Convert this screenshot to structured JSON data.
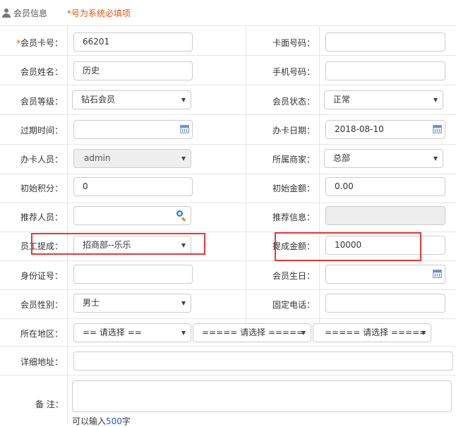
{
  "header": {
    "title": "会员信息",
    "note": "*号为系统必填项"
  },
  "form": {
    "card_no": {
      "required_mark": "*",
      "label": "会员卡号：",
      "value": "66201"
    },
    "face_no": {
      "label": "卡面号码：",
      "value": ""
    },
    "name": {
      "label": "会员姓名：",
      "value": "历史"
    },
    "mobile": {
      "label": "手机号码：",
      "value": ""
    },
    "level": {
      "label": "会员等级：",
      "value": "钻石会员"
    },
    "status": {
      "label": "会员状态：",
      "value": "正常"
    },
    "expire": {
      "label": "过期时间：",
      "value": ""
    },
    "open_date": {
      "label": "办卡日期：",
      "value": "2018-08-10"
    },
    "operator": {
      "label": "办卡人员：",
      "value": "admin"
    },
    "merchant": {
      "label": "所属商家：",
      "value": "总部"
    },
    "init_points": {
      "label": "初始积分：",
      "value": "0"
    },
    "init_amount": {
      "label": "初始金额：",
      "value": "0.00"
    },
    "referrer": {
      "label": "推荐人员：",
      "value": ""
    },
    "referrer_info": {
      "label": "推荐信息：",
      "value": ""
    },
    "staff_commission": {
      "label": "员工提成：",
      "value": "招商部--乐乐"
    },
    "commission_amount": {
      "label": "提成金额：",
      "value": "10000"
    },
    "id_card": {
      "label": "身份证号：",
      "value": ""
    },
    "birthday": {
      "label": "会员生日：",
      "value": ""
    },
    "gender": {
      "label": "会员性别：",
      "value": "男士"
    },
    "phone": {
      "label": "固定电话：",
      "value": ""
    },
    "region": {
      "label": "所在地区：",
      "province": "== 请选择 ==",
      "city": "===== 请选择 =====",
      "district": "===== 请选择 ====="
    },
    "address": {
      "label": "详细地址：",
      "value": ""
    },
    "remark": {
      "label": "备 注：",
      "value": "",
      "hint_prefix": "可以输入",
      "hint_count": "500",
      "hint_suffix": "字"
    }
  },
  "colors": {
    "accent_orange": "#e8550f",
    "highlight_red": "#e5383b",
    "count_blue": "#1a5fd6"
  }
}
